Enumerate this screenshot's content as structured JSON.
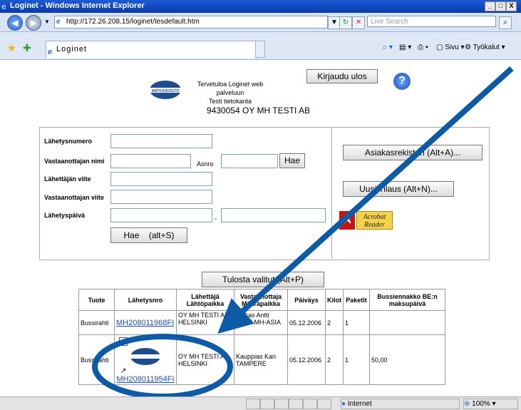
{
  "window": {
    "title": "Loginet - Windows Internet Explorer",
    "min": "_",
    "max": "□",
    "close": "X"
  },
  "address": {
    "url": "http://172.26.208.15/loginet/tesdefault.htm"
  },
  "search": {
    "placeholder": "Live Search"
  },
  "tab": {
    "title": "Loginet"
  },
  "toolbar": {
    "sivu": "Sivu",
    "tyokalut": "Työkalut"
  },
  "header": {
    "welcome_line1": "Tervetuloa Loginet web palveluun",
    "welcome_line2": "Testi tietokanta",
    "logout": "Kirjaudu ulos",
    "help": "?",
    "company": "9430054 OY MH TESTI AB",
    "logo_text": "MATKAHUOLTO"
  },
  "form": {
    "lahetysnumero": "Lähetysnumero",
    "vastaanottajan_nimi": "Vastaanottajan nimi",
    "asnro": "Asnro",
    "hae_small": "Hae",
    "lahettajan_viite": "Lähettäjän viite",
    "vastaanottajan_viite": "Vastaanottajan viite",
    "lahetyspaiva": "Lähetyspäivä",
    "dash": "-",
    "hae_button": "Hae    (alt+S)"
  },
  "side": {
    "asiakasrekisteri": "Asiakasrekisteri (Alt+A)...",
    "uusi_tilaus": "Uusi Tilaus (Alt+N)...",
    "acrobat1": "Acrobat",
    "acrobat2": "Reader"
  },
  "print_button": "Tulosta valitut (Alt+P)",
  "table": {
    "headers": [
      "Tuote",
      "Lähetysnro",
      "Lähettäjä Lähtöpaikka",
      "Vastaanottaja Määräpaikka",
      "Päiväys",
      "Kilot",
      "Paketit",
      "Bussiennakko BE:n maksupäivä"
    ],
    "rows": [
      {
        "tuote": "Bussirahti",
        "nro": "MH208011968FI",
        "lah1": "OY MH TESTI AB",
        "lah2": "HELSINKI",
        "vas1": "Asikas Antti",
        "vas2": "OITTI MH-ASIA",
        "pvm": "05.12.2006",
        "kilot": "2",
        "paketit": "1",
        "be": ""
      },
      {
        "tuote": "Bussirahti",
        "nro": "MH208011954FI",
        "lah1": "OY MH TESTI AB",
        "lah2": "HELSINKI",
        "vas1": "Kauppias Kari",
        "vas2": "TAMPERE",
        "pvm": "05.12.2006",
        "kilot": "2",
        "paketit": "1",
        "be": "50,00"
      }
    ]
  },
  "status": {
    "zone": "Internet",
    "zoom": "100%"
  },
  "colors": {
    "annotation": "#0d5aa7",
    "titlebar": "#0a3aa8"
  }
}
